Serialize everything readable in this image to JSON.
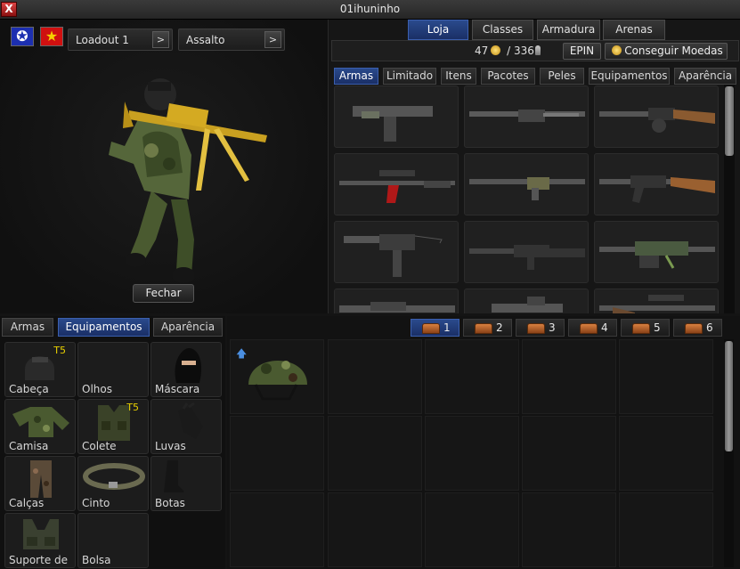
{
  "window": {
    "title": "01ihuninho",
    "close_glyph": "X"
  },
  "character": {
    "loadout": "Loadout 1",
    "class_select": "Assalto",
    "dropdown_arrow": ">",
    "close_button": "Fechar"
  },
  "store": {
    "top_tabs": [
      "Loja",
      "Classes",
      "Armadura",
      "Arenas"
    ],
    "active_top_tab": "Loja",
    "coins": "47",
    "keys": "/ 336",
    "epin": "EPIN",
    "get_coins": "Conseguir Moedas",
    "sub_tabs": [
      "Armas",
      "Limitado",
      "Itens",
      "Pacotes",
      "Peles",
      "Equipamentos",
      "Aparência"
    ],
    "active_sub_tab": "Armas",
    "weapons": [
      "uzi",
      "assault-rifle-folding",
      "ppsh",
      "sniper-red-mag",
      "fal",
      "ak-wood",
      "mac10-suppressed",
      "m16",
      "lmg-green",
      "rifle-4",
      "smg-4",
      "sniper-4"
    ]
  },
  "equipment": {
    "tabs": [
      "Armas",
      "Equipamentos",
      "Aparência"
    ],
    "active_tab": "Equipamentos",
    "slots": [
      {
        "label": "Cabeça",
        "tier": "T5",
        "icon": "helmet-icon"
      },
      {
        "label": "Olhos",
        "tier": "",
        "icon": ""
      },
      {
        "label": "Máscara",
        "tier": "",
        "icon": "balaclava-icon"
      },
      {
        "label": "Camisa",
        "tier": "",
        "icon": "shirt-icon"
      },
      {
        "label": "Colete",
        "tier": "T5",
        "icon": "vest-icon"
      },
      {
        "label": "Luvas",
        "tier": "",
        "icon": "gloves-icon"
      },
      {
        "label": "Calças",
        "tier": "",
        "icon": "pants-icon"
      },
      {
        "label": "Cinto",
        "tier": "",
        "icon": "belt-icon"
      },
      {
        "label": "Botas",
        "tier": "",
        "icon": "boots-icon"
      },
      {
        "label": "Suporte de",
        "tier": "",
        "icon": "harness-icon"
      },
      {
        "label": "Bolsa",
        "tier": "",
        "icon": ""
      }
    ]
  },
  "inventory": {
    "pages": [
      "1",
      "2",
      "3",
      "4",
      "5",
      "6"
    ],
    "active_page": "1",
    "first_item": "camo-helmet-icon"
  },
  "colors": {
    "accent_blue": "#2a4a8c",
    "tier_yellow": "#e8d000",
    "close_red": "#c02020"
  }
}
